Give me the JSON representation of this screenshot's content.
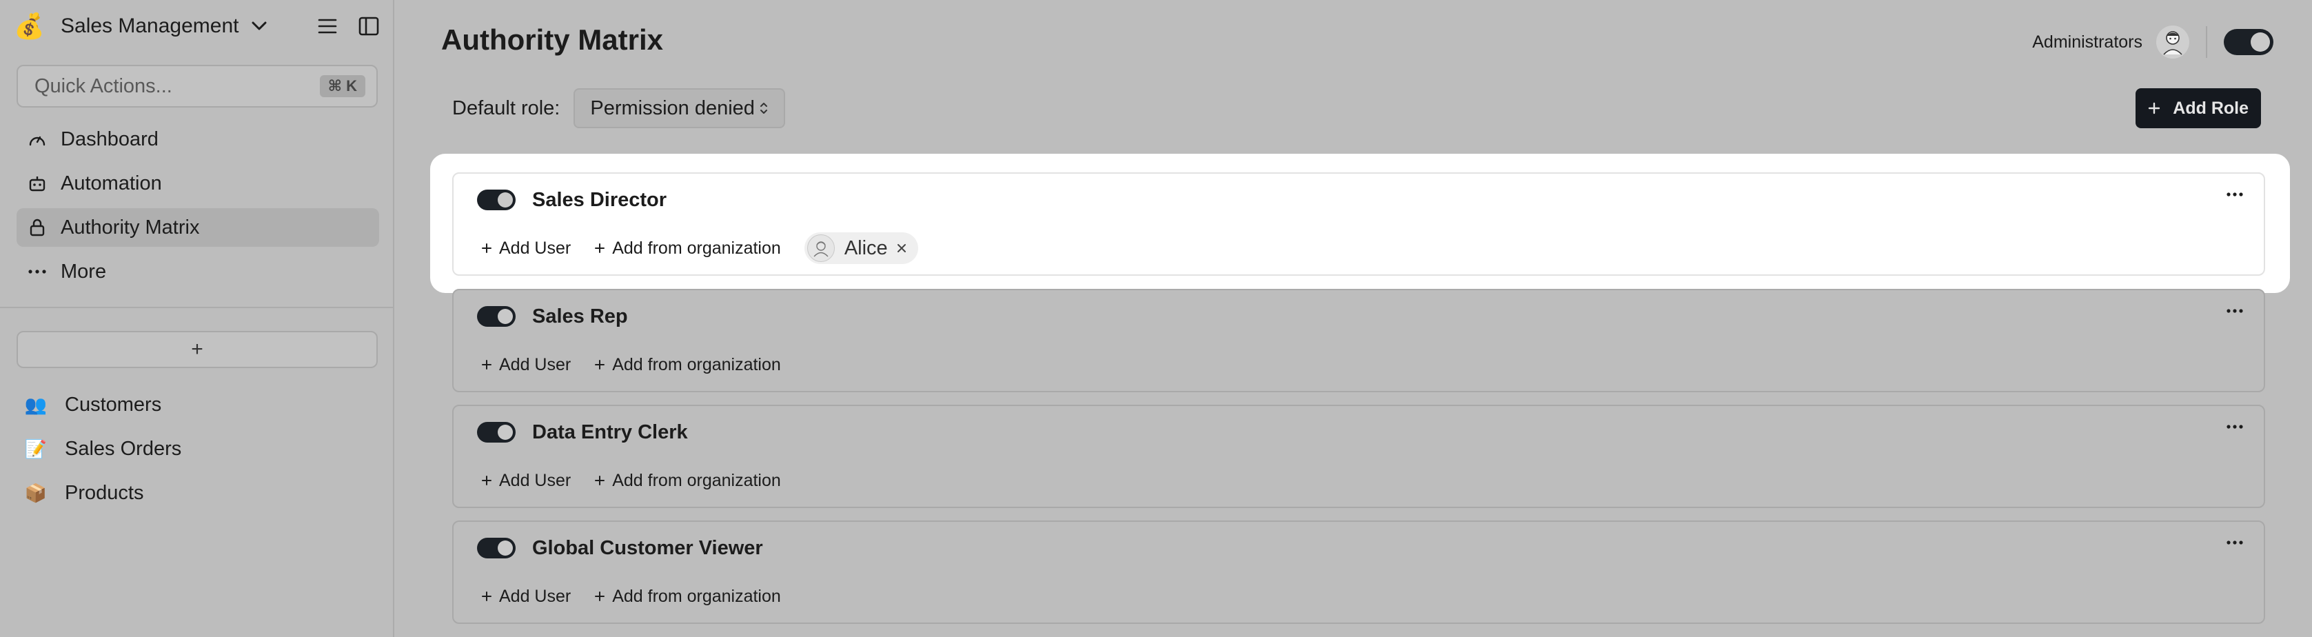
{
  "workspace": {
    "emoji": "💰",
    "name": "Sales Management"
  },
  "search": {
    "label": "Quick Actions...",
    "shortcut": "⌘ K"
  },
  "nav": [
    {
      "label": "Dashboard",
      "icon": "dashboard-gauge-icon"
    },
    {
      "label": "Automation",
      "icon": "robot-icon"
    },
    {
      "label": "Authority Matrix",
      "icon": "lock-icon",
      "active": true
    },
    {
      "label": "More",
      "icon": "ellipsis-icon"
    }
  ],
  "add_table_label": "+",
  "tables": [
    {
      "emoji": "👥",
      "label": "Customers"
    },
    {
      "emoji": "📝",
      "label": "Sales Orders"
    },
    {
      "emoji": "📦",
      "label": "Products"
    }
  ],
  "page": {
    "title": "Authority Matrix"
  },
  "header": {
    "user_group": "Administrators",
    "toggle_on": true
  },
  "default_role": {
    "label": "Default role:",
    "value": "Permission denied"
  },
  "add_role_label": "Add Role",
  "roles": [
    {
      "name": "Sales Director",
      "enabled": true,
      "add_user": "Add User",
      "add_org": "Add from organization",
      "users": [
        "Alice"
      ]
    },
    {
      "name": "Sales Rep",
      "enabled": true,
      "add_user": "Add User",
      "add_org": "Add from organization",
      "users": []
    },
    {
      "name": "Data Entry Clerk",
      "enabled": true,
      "add_user": "Add User",
      "add_org": "Add from organization",
      "users": []
    },
    {
      "name": "Global Customer Viewer",
      "enabled": true,
      "add_user": "Add User",
      "add_org": "Add from organization",
      "users": []
    }
  ],
  "colors": {
    "overlay_gray": "#bdbdbd",
    "dark": "#15191f",
    "highlight": "#ffffff"
  }
}
